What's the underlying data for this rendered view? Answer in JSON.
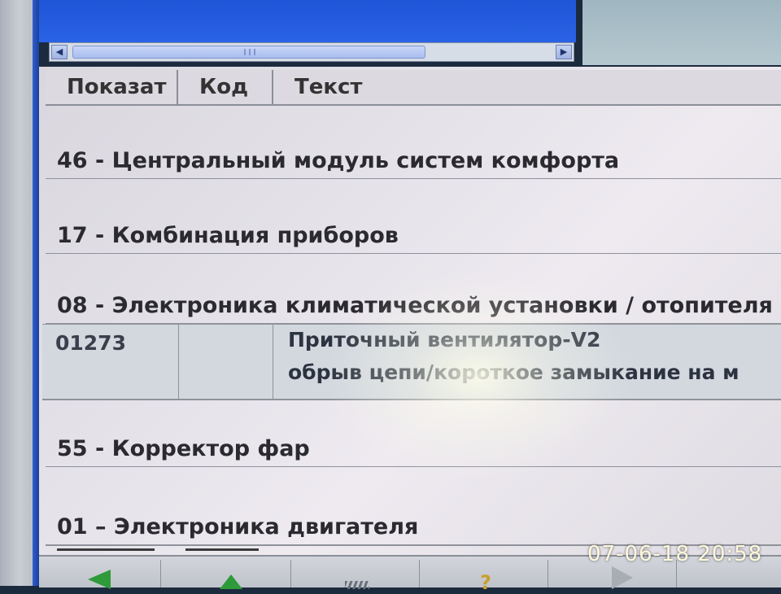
{
  "table": {
    "columns": {
      "show": "Показат",
      "code": "Код",
      "text": "Текст"
    },
    "groups": {
      "g46": "46 - Центральный модуль систем комфорта",
      "g17": "17 - Комбинация приборов",
      "g08": "08 - Электроника климатической установки / отопителя",
      "g55": "55 - Корректор фар",
      "g01": "01 – Электроника двигателя"
    },
    "fault": {
      "code": "01273",
      "line1": "Приточный вентилятор-V2",
      "line2": "обрыв цепи/короткое замыкание на м"
    }
  },
  "toolbar": {
    "icons": [
      "arrow-left-icon",
      "arrow-up-icon",
      "edit-icon",
      "help-icon",
      "play-icon"
    ],
    "help_glyph": "?"
  },
  "photo": {
    "timestamp": "07-06-18 20:58"
  }
}
